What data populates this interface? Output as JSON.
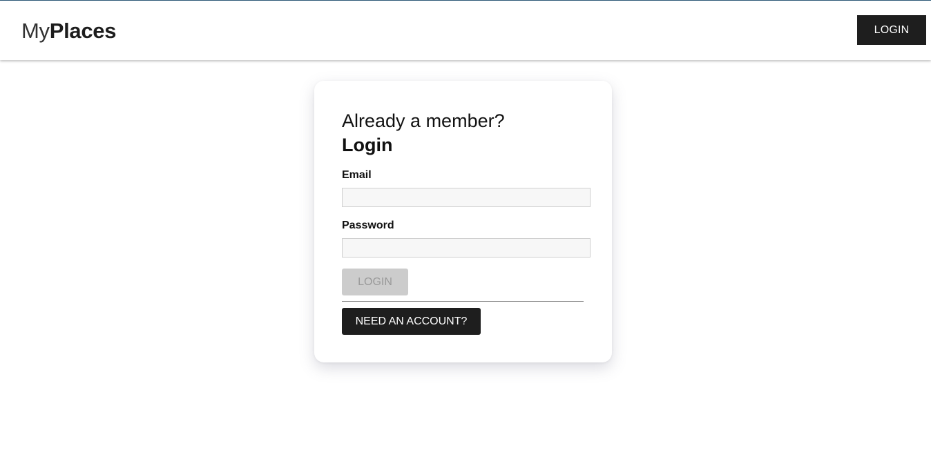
{
  "header": {
    "brand_light": "My",
    "brand_bold": "Places",
    "login_label": "LOGIN"
  },
  "auth_card": {
    "subtitle": "Already a member?",
    "title": "Login",
    "email_label": "Email",
    "email_value": "",
    "password_label": "Password",
    "password_value": "",
    "submit_label": "LOGIN",
    "submit_disabled": true,
    "switch_label": "NEED AN ACCOUNT?"
  },
  "colors": {
    "header_bar": "#2d5a78",
    "button_dark": "#1e1e1e",
    "button_disabled": "#cccccc",
    "input_background": "#f7f7f7"
  }
}
